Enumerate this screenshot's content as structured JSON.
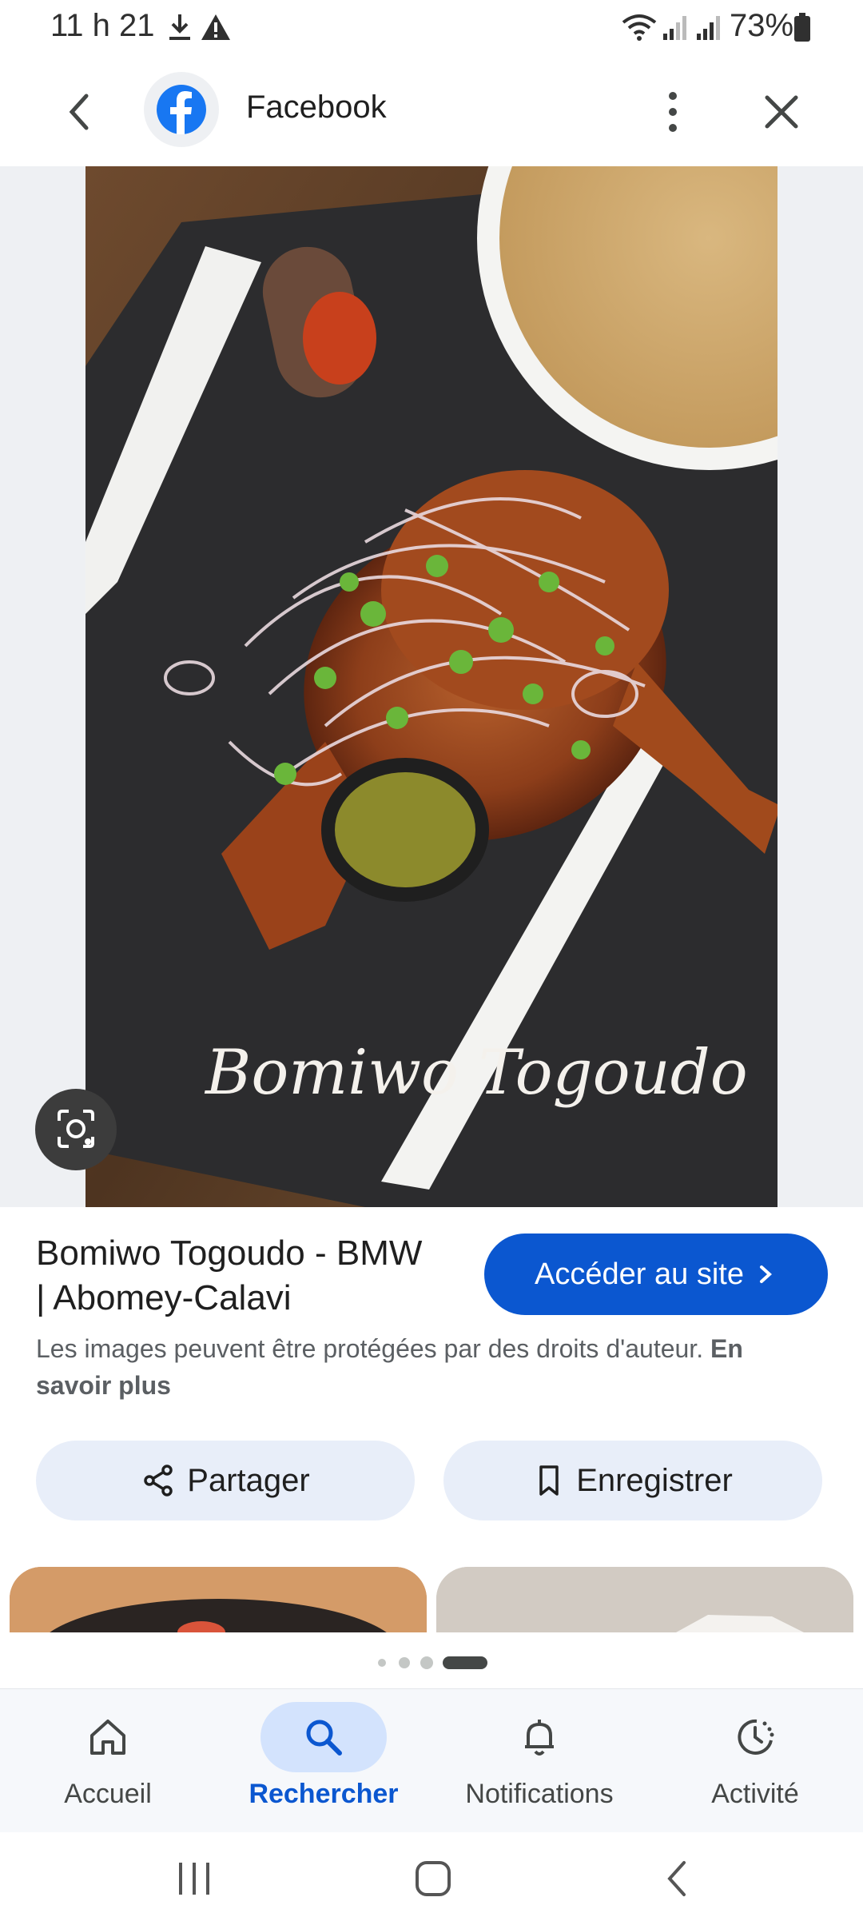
{
  "status_bar": {
    "time": "11 h 21",
    "battery": "73%"
  },
  "app_bar": {
    "title": "Facebook",
    "icons": [
      "back-icon",
      "facebook-logo-icon",
      "more-vert-icon",
      "close-icon"
    ]
  },
  "image_caption": "Bomiwo Togoudo",
  "result": {
    "title_line1": "Bomiwo Togoudo - BMW",
    "title_line2": "| Abomey-Calavi",
    "visit_label": "Accéder au site",
    "copyright_text": "Les images peuvent être protégées par des droits d'auteur.",
    "learn_more": "En savoir plus"
  },
  "actions": {
    "share_label": "Partager",
    "save_label": "Enregistrer"
  },
  "bottom_nav": [
    {
      "label": "Accueil",
      "icon": "home-icon"
    },
    {
      "label": "Rechercher",
      "icon": "search-icon",
      "active": true
    },
    {
      "label": "Notifications",
      "icon": "bell-icon"
    },
    {
      "label": "Activité",
      "icon": "activity-icon"
    }
  ],
  "colors": {
    "accent": "#0b57d0",
    "pill_bg": "#e8eef9",
    "nav_active_bg": "#d3e3fd"
  }
}
